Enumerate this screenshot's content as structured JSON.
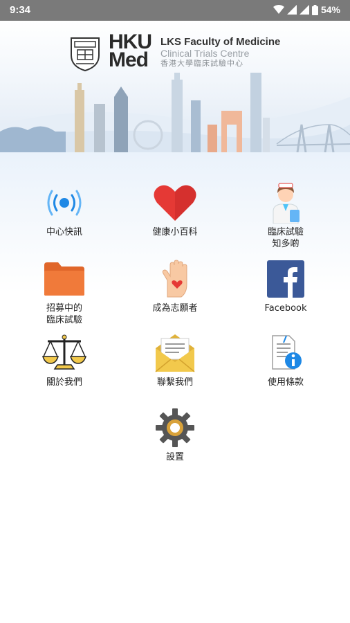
{
  "status_bar": {
    "time": "9:34",
    "battery": "54%"
  },
  "header": {
    "logo_hku": "HKU",
    "logo_med": "Med",
    "faculty": "LKS Faculty of Medicine",
    "centre": "Clinical Trials Centre",
    "centre_zh": "香港大學臨床試驗中心"
  },
  "menu": [
    {
      "label": "中心快訊",
      "icon": "broadcast-icon"
    },
    {
      "label": "健康小百科",
      "icon": "heart-icon"
    },
    {
      "label": "臨床試驗\n知多啲",
      "icon": "doctor-icon"
    },
    {
      "label": "招募中的\n臨床試驗",
      "icon": "folder-icon"
    },
    {
      "label": "成為志願者",
      "icon": "volunteer-hand-icon"
    },
    {
      "label": "Facebook",
      "icon": "facebook-icon"
    },
    {
      "label": "關於我們",
      "icon": "scales-icon"
    },
    {
      "label": "聯繫我們",
      "icon": "envelope-icon"
    },
    {
      "label": "使用條款",
      "icon": "document-info-icon"
    },
    {
      "label": "設置",
      "icon": "gear-icon"
    }
  ],
  "colors": {
    "status_bar": "#7a7a7a",
    "heart": "#e53935",
    "folder": "#f07a3a",
    "facebook": "#3b5998",
    "broadcast": "#1e88e5"
  }
}
